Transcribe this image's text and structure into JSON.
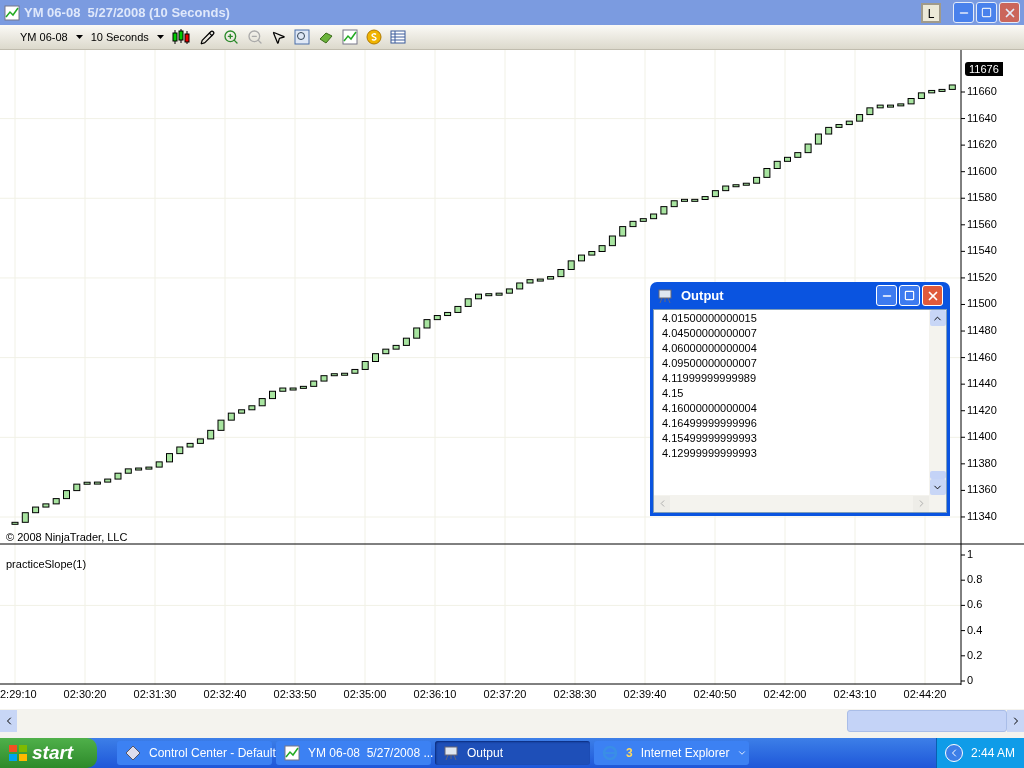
{
  "window": {
    "title": "YM 06-08  5/27/2008 (10 Seconds)",
    "mode_button": "L"
  },
  "toolbar": {
    "instrument": "YM 06-08",
    "interval": "10 Seconds"
  },
  "price_panel": {
    "last_price": "11676",
    "y_labels": [
      "11660",
      "11640",
      "11620",
      "11600",
      "11580",
      "11560",
      "11540",
      "11520",
      "11500",
      "11480",
      "11460",
      "11440",
      "11420",
      "11400",
      "11380",
      "11360",
      "11340"
    ],
    "copyright": "© 2008 NinjaTrader, LLC"
  },
  "indicator_panel": {
    "label": "practiceSlope(1)",
    "y_labels": [
      "1",
      "0.8",
      "0.6",
      "0.4",
      "0.2",
      "0"
    ]
  },
  "time_axis": {
    "labels": [
      "2:29:10",
      "02:30:20",
      "02:31:30",
      "02:32:40",
      "02:33:50",
      "02:35:00",
      "02:36:10",
      "02:37:20",
      "02:38:30",
      "02:39:40",
      "02:40:50",
      "02:42:00",
      "02:43:10",
      "02:44:20"
    ]
  },
  "output_window": {
    "title": "Output",
    "lines": [
      "4.01500000000015",
      "4.04500000000007",
      "4.06000000000004",
      "4.09500000000007",
      "4.11999999999989",
      "4.15",
      "4.16000000000004",
      "4.16499999999996",
      "4.15499999999993",
      "4.12999999999993"
    ]
  },
  "taskbar": {
    "start": "start",
    "items": [
      {
        "kind": "app",
        "label": "Control Center - Default",
        "selected": false
      },
      {
        "kind": "chart",
        "label": "YM 06-08  5/27/2008 ...",
        "selected": false
      },
      {
        "kind": "output",
        "label": "Output",
        "selected": true
      },
      {
        "kind": "browser",
        "count": "3",
        "label": "Internet Explorer",
        "selected": false
      }
    ],
    "clock": "2:44 AM"
  }
}
